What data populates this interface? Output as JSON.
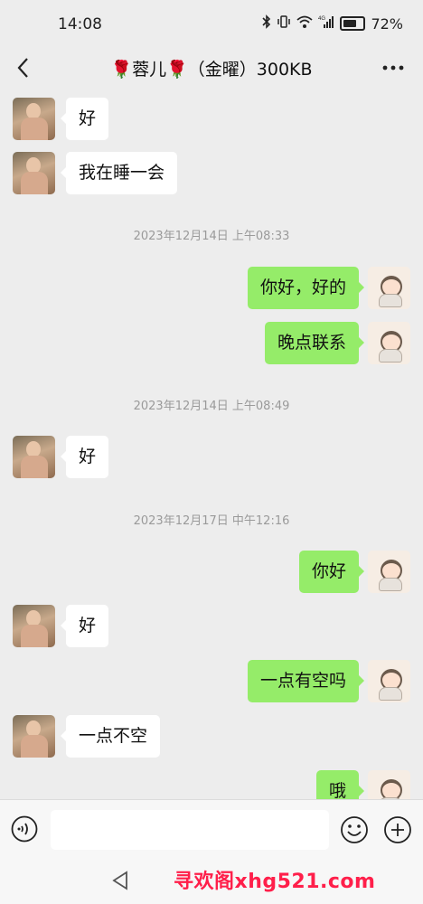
{
  "status_bar": {
    "time": "14:08",
    "battery": "72%",
    "network": "4G"
  },
  "header": {
    "title": "🌹蓉儿🌹（金曜）300KB"
  },
  "messages": [
    {
      "side": "left",
      "text": "好"
    },
    {
      "side": "left",
      "text": "我在睡一会"
    },
    {
      "type": "time",
      "text": "2023年12月14日 上午08:33"
    },
    {
      "side": "right",
      "text": "你好，好的"
    },
    {
      "side": "right",
      "text": "晚点联系"
    },
    {
      "type": "time",
      "text": "2023年12月14日 上午08:49"
    },
    {
      "side": "left",
      "text": "好"
    },
    {
      "type": "time",
      "text": "2023年12月17日 中午12:16"
    },
    {
      "side": "right",
      "text": "你好"
    },
    {
      "side": "left",
      "text": "好"
    },
    {
      "side": "right",
      "text": "一点有空吗"
    },
    {
      "side": "left",
      "text": "一点不空"
    },
    {
      "side": "right",
      "text": "哦"
    }
  ],
  "input": {
    "value": ""
  },
  "watermark": "寻欢阁xhg521.com",
  "icons": {
    "back": "chevron-left-icon",
    "more": "more-dots-icon",
    "voice": "voice-icon",
    "emoji": "emoji-icon",
    "plus": "plus-icon",
    "sys_back": "triangle-back-icon"
  },
  "colors": {
    "sent_bubble": "#95ec69",
    "received_bubble": "#ffffff",
    "background": "#ededed",
    "watermark": "#ff1f4a"
  }
}
